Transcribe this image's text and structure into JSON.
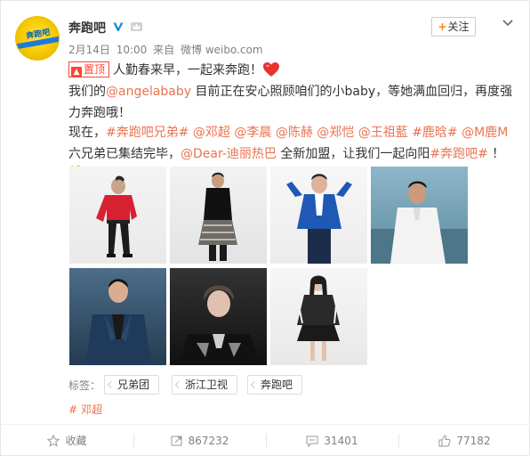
{
  "user": {
    "name": "奔跑吧",
    "verified_icon": "verified-v-icon",
    "member_icon": "member-icon",
    "avatar_text": "奔跑吧"
  },
  "meta": {
    "date": "2月14日",
    "time": "10:00",
    "source_prefix": "来自",
    "source": "微博 weibo.com"
  },
  "follow_label": "关注",
  "post": {
    "pin_label": "置顶",
    "line1": "人勤春来早，一起来奔跑！",
    "line2_pre": "我们的",
    "mention_angelababy": "@angelababy",
    "line2_post": " 目前正在安心照顾咱们的小baby，等她满血回归，再度强力奔跑哦！",
    "line3_pre": "现在，",
    "t_brothers": "#奔跑吧兄弟#",
    "m_dengchao": "@邓超",
    "m_lichen": "@李晨",
    "m_chenhe": "@陈赫",
    "m_zhengkai": "@郑恺",
    "m_wangzulan": "@王祖藍",
    "t_luhan": "#鹿晗#",
    "m_luhan": "@M鹿M",
    "line3_mid": " 六兄弟已集结完毕，",
    "m_dilireba": "@Dear-迪丽热巴",
    "line3_mid2": " 全新加盟，让我们一起向阳",
    "t_benpaoba": "#奔跑吧#",
    "line3_end": " ！"
  },
  "tags": {
    "label": "标签：",
    "items": [
      "兄弟团",
      "浙江卫视",
      "奔跑吧"
    ]
  },
  "topic": {
    "hash": "#",
    "name": "邓超"
  },
  "actions": {
    "favorite": "收藏",
    "repost": "867232",
    "comment": "31401",
    "like": "77182"
  },
  "colors": {
    "link": "#eb7350",
    "pin": "#ff4433",
    "follow_plus": "#ff8200"
  }
}
